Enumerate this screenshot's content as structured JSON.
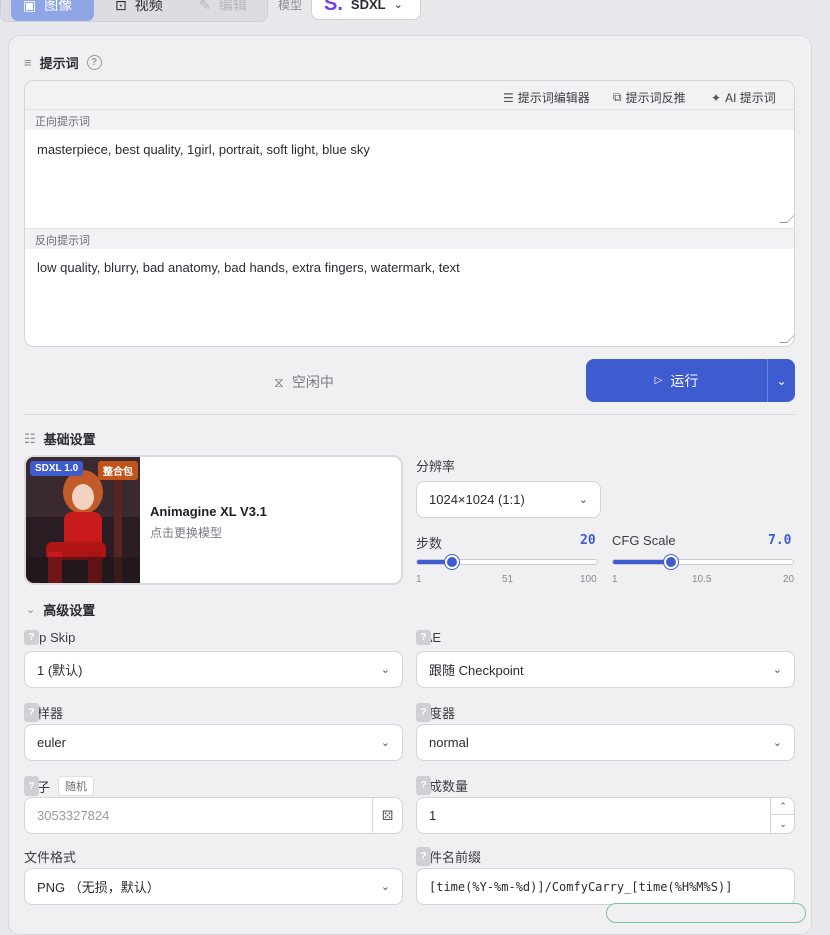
{
  "mode_tabs": [
    {
      "label": "图像",
      "icon": "image-icon",
      "state": "active"
    },
    {
      "label": "视频",
      "icon": "video-icon",
      "state": "normal"
    },
    {
      "label": "编辑",
      "icon": "edit-icon",
      "state": "disabled"
    }
  ],
  "model": {
    "label": "模型",
    "selected": "SDXL"
  },
  "prompt_section": {
    "title": "提示词",
    "toolbar": {
      "editor": "提示词编辑器",
      "reverse": "提示词反推",
      "ai": "AI 提示词"
    },
    "positive_label": "正向提示词",
    "positive_value": "masterpiece, best quality, 1girl, portrait, soft light, blue sky",
    "negative_label": "反向提示词",
    "negative_value": "low quality, blurry, bad anatomy, bad hands, extra fingers, watermark, text"
  },
  "run": {
    "status": "空闲中",
    "button": "运行"
  },
  "basic": {
    "title": "基础设置",
    "model_card": {
      "badge_version": "SDXL 1.0",
      "badge_pack": "整合包",
      "name": "Animagine XL V3.1",
      "hint": "点击更换模型"
    },
    "resolution": {
      "label": "分辨率",
      "value": "1024×1024 (1:1)"
    },
    "steps": {
      "label": "步数",
      "value": "20",
      "min": "1",
      "mid": "51",
      "max": "100",
      "fraction": 0.192
    },
    "cfg": {
      "label": "CFG Scale",
      "value": "7.0",
      "min": "1",
      "mid": "10.5",
      "max": "20",
      "fraction": 0.316
    }
  },
  "advanced": {
    "title": "高级设置",
    "clip_skip": {
      "label": "Clip Skip",
      "value": "1 (默认)"
    },
    "vae": {
      "label": "VAE",
      "value": "跟随 Checkpoint"
    },
    "sampler": {
      "label": "采样器",
      "value": "euler"
    },
    "scheduler": {
      "label": "调度器",
      "value": "normal"
    },
    "seed": {
      "label": "种子",
      "random_tag": "随机",
      "placeholder": "3053327824"
    },
    "batch": {
      "label": "生成数量",
      "value": "1"
    },
    "format": {
      "label": "文件格式",
      "value": "PNG （无损，默认）"
    },
    "prefix": {
      "label": "文件名前缀",
      "value": "[time(%Y-%m-%d)]/ComfyCarry_[time(%H%M%S)]"
    }
  },
  "colors": {
    "accent": "#3f5bd0",
    "active_tab": "#8ea6e6",
    "logo": "#7b3fe4"
  }
}
